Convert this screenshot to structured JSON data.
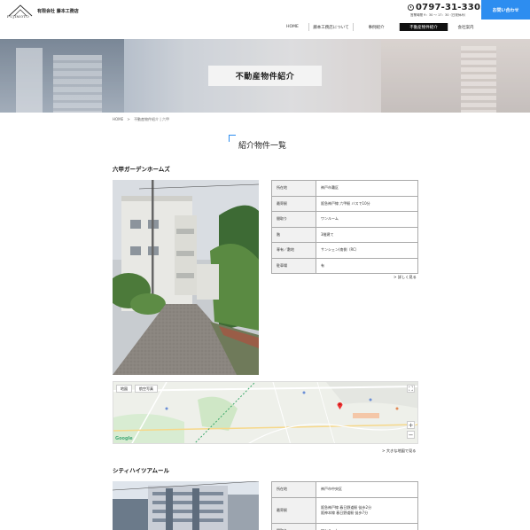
{
  "header": {
    "logo_text": "FUJIMOTO",
    "company": "有限会社 藤本工務店",
    "phone": "0797-31-3305",
    "hours": "営業時間 9：30 ～ 17：30（日祝休み）",
    "contact_label": "お問い合わせ"
  },
  "nav": [
    {
      "label": "HOME",
      "active": false
    },
    {
      "label": "藤本工務店について",
      "active": false
    },
    {
      "label": "事例紹介",
      "active": false
    },
    {
      "label": "不動産物件紹介",
      "active": true
    },
    {
      "label": "会社案内",
      "active": false
    }
  ],
  "hero": {
    "title": "不動産物件紹介"
  },
  "breadcrumb": {
    "home": "HOME",
    "sep": ">",
    "current": "不動産物件紹介 | 六甲"
  },
  "section": {
    "title": "紹介物件一覧"
  },
  "properties": [
    {
      "name": "六甲ガーデンホームズ",
      "rows": [
        {
          "key": "所在地",
          "value": "神戸市灘区"
        },
        {
          "key": "最寄駅",
          "value": "阪急神戸線 六甲駅 バスで10分"
        },
        {
          "key": "間取り",
          "value": "ワンルーム"
        },
        {
          "key": "階",
          "value": "3階建て"
        },
        {
          "key": "専有／敷地",
          "value": "サンシェン(南側（RC）"
        },
        {
          "key": "駐車場",
          "value": "有"
        }
      ],
      "more_label": "詳しく見る",
      "map": {
        "tab_map": "地図",
        "tab_satellite": "航空写真",
        "google": "Google",
        "zoom_in": "+",
        "zoom_out": "−",
        "fullscreen": "⛶"
      },
      "map_link": "大きな地図で見る"
    },
    {
      "name": "シティハイツアムール",
      "rows": [
        {
          "key": "所在地",
          "value": "神戸市中央区"
        },
        {
          "key": "最寄駅",
          "value": "阪急神戸線 春日野道駅 徒歩2分\n阪神本線 春日野道駅 徒歩7分"
        },
        {
          "key": "間取り",
          "value": "ワンルーム"
        }
      ]
    }
  ]
}
